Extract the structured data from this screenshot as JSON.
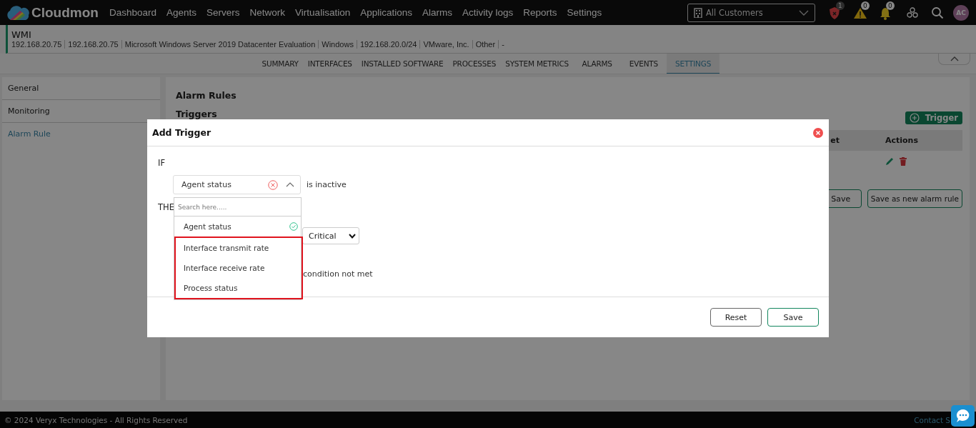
{
  "header": {
    "logo": "Cloudmon",
    "nav": [
      "Dashboard",
      "Agents",
      "Servers",
      "Network",
      "Virtualisation",
      "Applications",
      "Alarms",
      "Activity logs",
      "Reports",
      "Settings"
    ],
    "customer_select": {
      "value": "All Customers"
    },
    "badges": [
      {
        "kind": "shield",
        "count": "1"
      },
      {
        "kind": "warning",
        "count": "0"
      },
      {
        "kind": "bell",
        "count": "0"
      }
    ],
    "avatar": "AC"
  },
  "device": {
    "name": "WMI",
    "details": [
      "192.168.20.75",
      "192.168.20.75",
      "Microsoft Windows Server 2019 Datacenter Evaluation",
      "Windows",
      "192.168.20.0/24",
      "VMware, Inc.",
      "Other",
      "-"
    ]
  },
  "tabs": [
    {
      "label": "SUMMARY",
      "selected": false
    },
    {
      "label": "INTERFACES",
      "selected": false
    },
    {
      "label": "INSTALLED SOFTWARE",
      "selected": false
    },
    {
      "label": "PROCESSES",
      "selected": false
    },
    {
      "label": "SYSTEM METRICS",
      "selected": false
    },
    {
      "label": "ALARMS",
      "selected": false
    },
    {
      "label": "EVENTS",
      "selected": false
    },
    {
      "label": "SETTINGS",
      "selected": true
    }
  ],
  "sidebar": {
    "items": [
      {
        "label": "General",
        "selected": false
      },
      {
        "label": "Monitoring",
        "selected": false
      },
      {
        "label": "Alarm Rule",
        "selected": true
      }
    ]
  },
  "alarm_rules": {
    "title": "Alarm Rules",
    "triggers_title": "Triggers",
    "add_button": "Trigger",
    "table": {
      "columns": [
        "et",
        "Actions"
      ]
    },
    "buttons": [
      "Save",
      "Save as new alarm rule"
    ]
  },
  "modal": {
    "title": "Add Trigger",
    "if_label": "IF",
    "condition_select": {
      "value": "Agent status",
      "expanded": true
    },
    "condition_text": "is inactive",
    "then_label": "THE",
    "severity_select": {
      "value": "Critical"
    },
    "option_text": "condition not met",
    "dropdown": {
      "placeholder": "Search here.....",
      "options": [
        {
          "label": "Agent status",
          "selected": true,
          "highlighted": false
        },
        {
          "label": "Interface transmit rate",
          "selected": false,
          "highlighted": true
        },
        {
          "label": "Interface receive rate",
          "selected": false,
          "highlighted": true
        },
        {
          "label": "Process status",
          "selected": false,
          "highlighted": true
        }
      ]
    },
    "buttons": [
      "Reset",
      "Save"
    ]
  },
  "footer": {
    "copyright": "© 2024 Veryx Technologies - All Rights Reserved",
    "link": "Contact S"
  }
}
